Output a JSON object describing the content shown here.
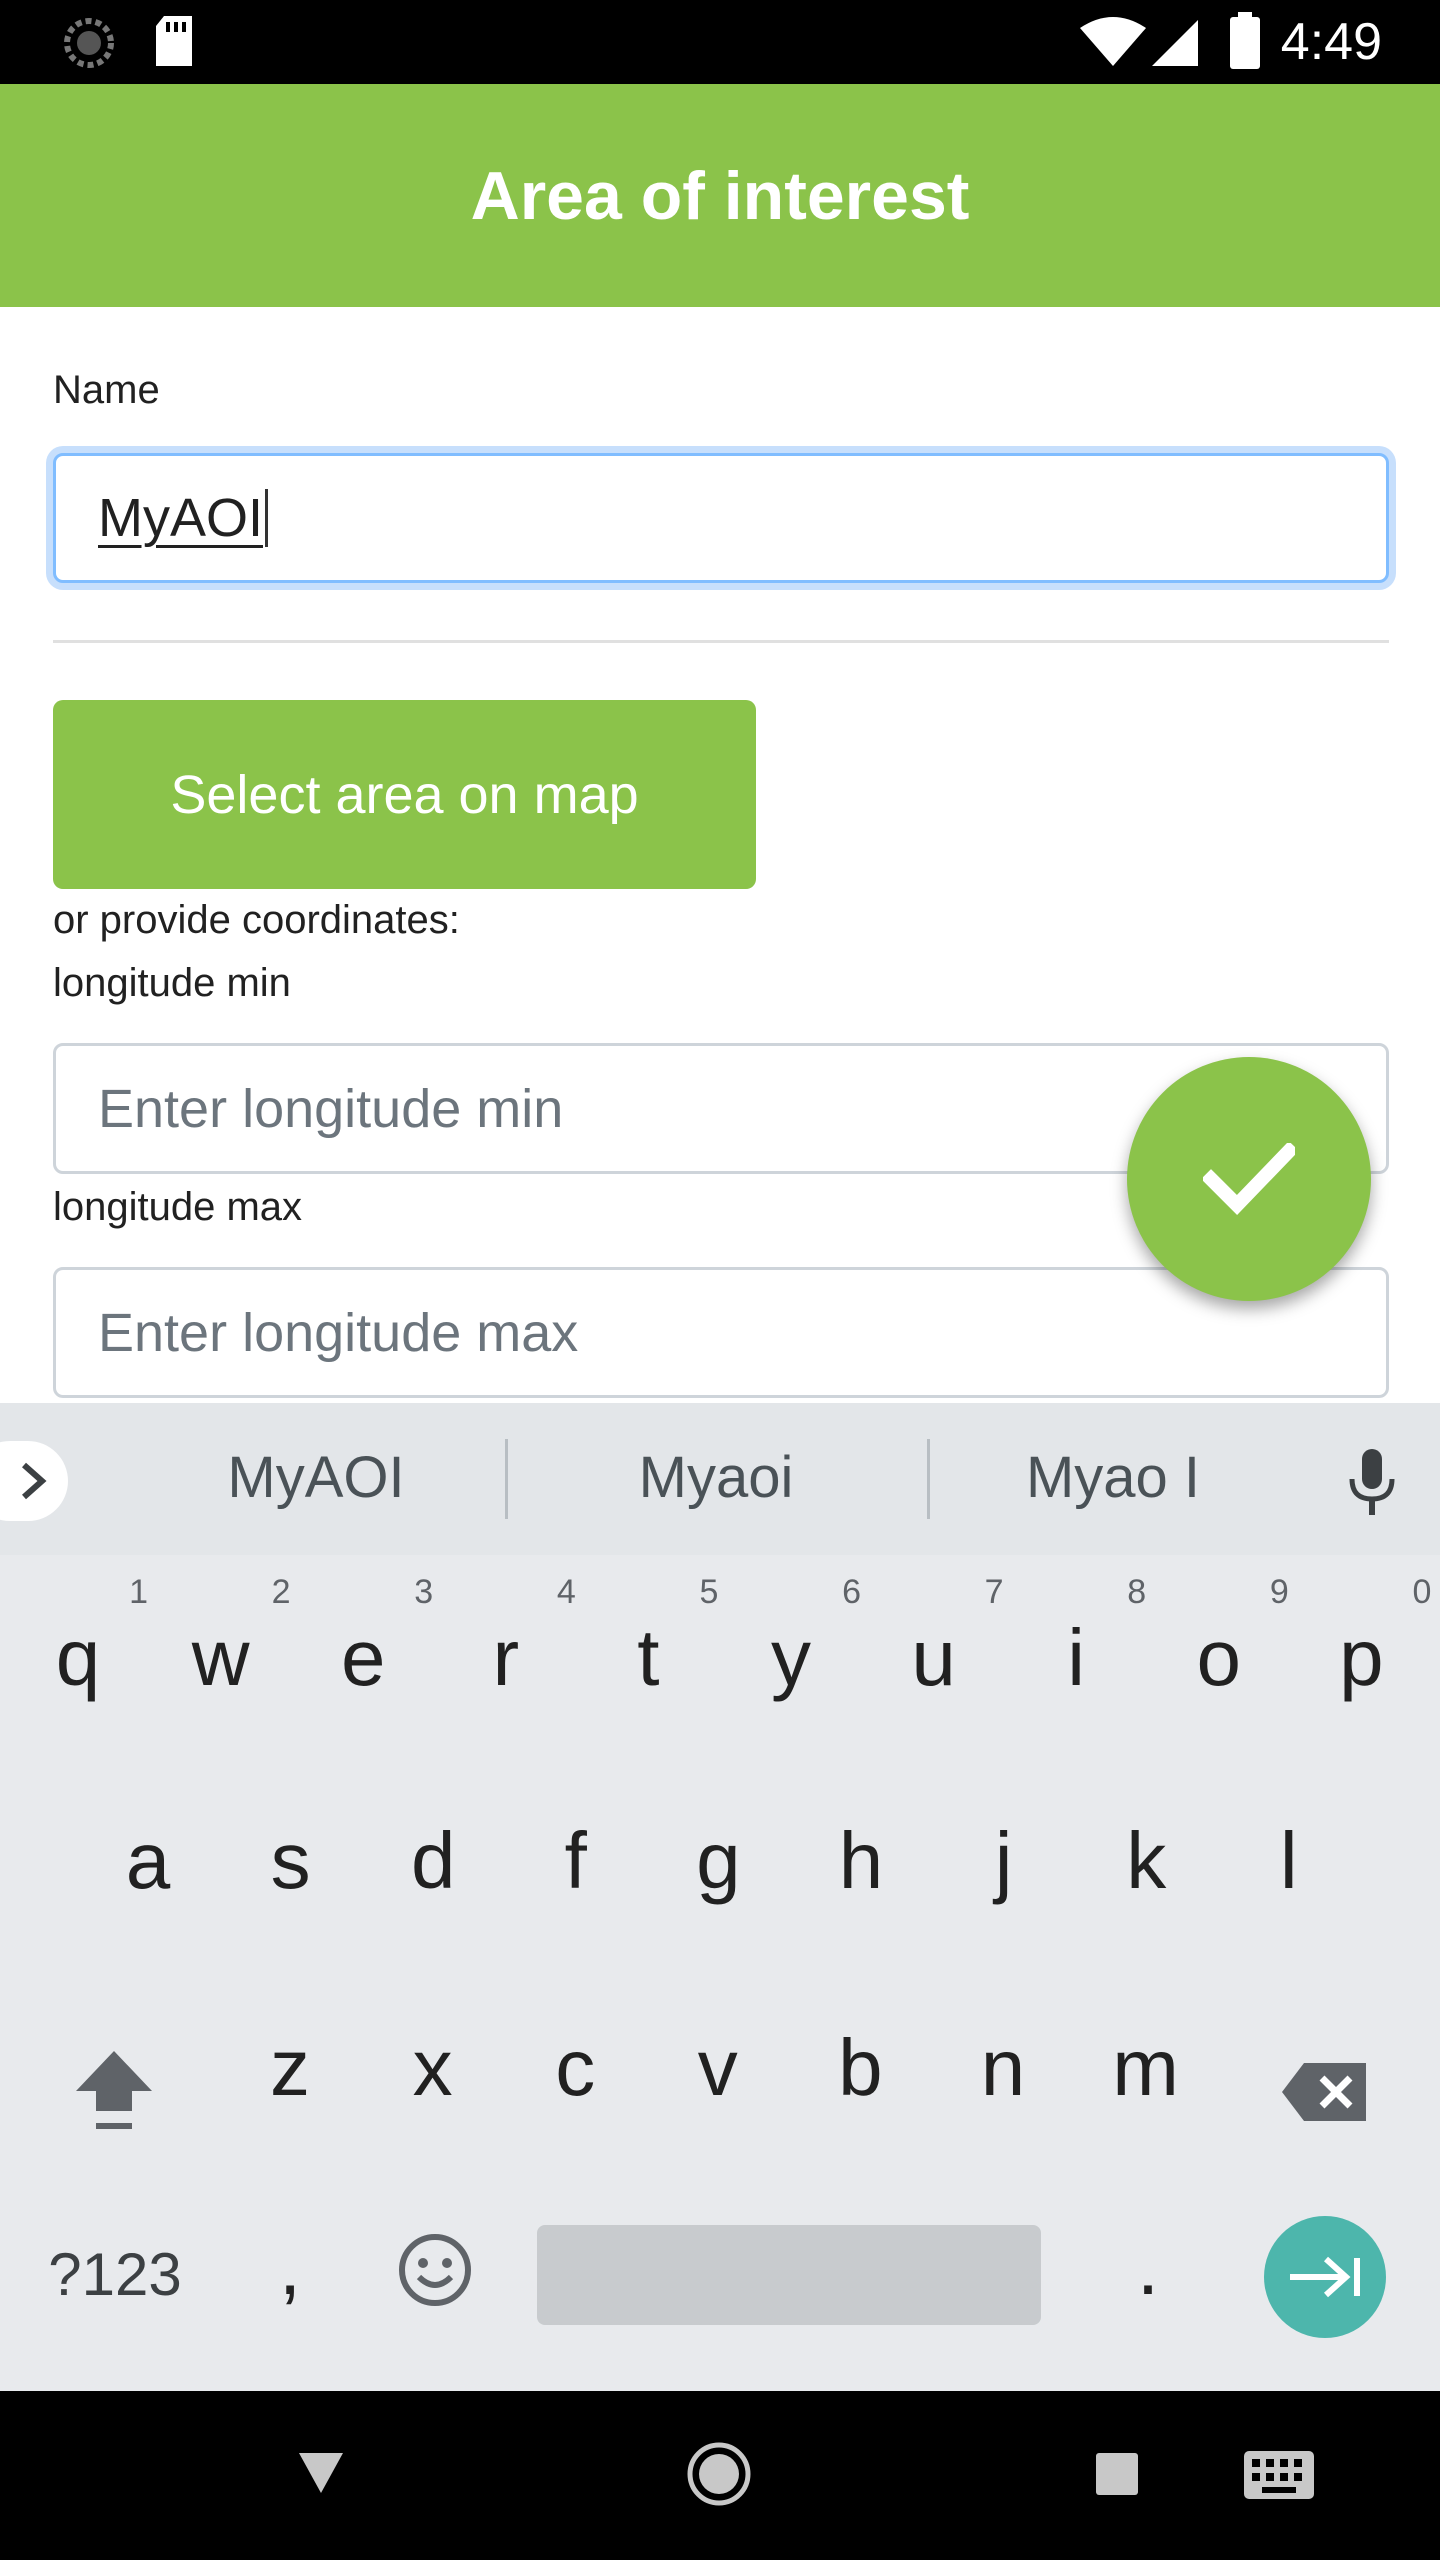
{
  "status_bar": {
    "time": "4:49"
  },
  "header": {
    "title": "Area of interest"
  },
  "form": {
    "name_label": "Name",
    "name_value": "MyAOI",
    "select_button": "Select area on map",
    "coords_label": "or provide coordinates:",
    "lon_min_label": "longitude min",
    "lon_min_placeholder": "Enter longitude min",
    "lon_max_label": "longitude max",
    "lon_max_placeholder": "Enter longitude max"
  },
  "keyboard": {
    "suggestions": [
      "MyAOI",
      "Myaoi",
      "Myao I"
    ],
    "row1": [
      "q",
      "w",
      "e",
      "r",
      "t",
      "y",
      "u",
      "i",
      "o",
      "p"
    ],
    "row1_hints": [
      "1",
      "2",
      "3",
      "4",
      "5",
      "6",
      "7",
      "8",
      "9",
      "0"
    ],
    "row2": [
      "a",
      "s",
      "d",
      "f",
      "g",
      "h",
      "j",
      "k",
      "l"
    ],
    "row3": [
      "z",
      "x",
      "c",
      "v",
      "b",
      "n",
      "m"
    ],
    "symbols_key": "?123",
    "comma_key": ",",
    "period_key": "."
  },
  "colors": {
    "accent": "#8bc34a",
    "enter": "#4db6ac"
  },
  "icons": [
    "sync-icon",
    "sd-card-icon",
    "wifi-icon",
    "signal-icon",
    "battery-icon",
    "check-icon",
    "chevron-right-icon",
    "microphone-icon",
    "shift-icon",
    "backspace-icon",
    "emoji-icon",
    "enter-icon",
    "back-icon",
    "home-icon",
    "recents-icon",
    "keyboard-icon"
  ]
}
